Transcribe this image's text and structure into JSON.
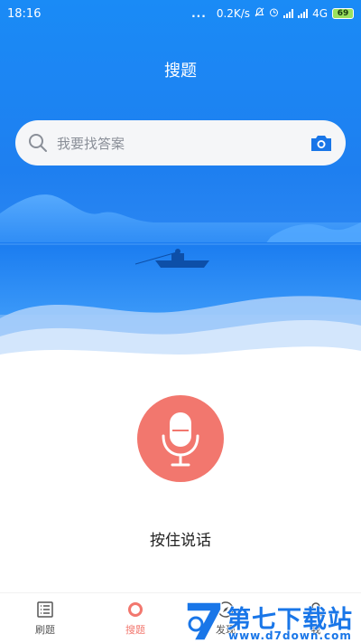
{
  "status_bar": {
    "time": "18:16",
    "dots": "...",
    "speed": "0.2K/s",
    "network": "4G",
    "battery": "69"
  },
  "header": {
    "title": "搜题"
  },
  "search": {
    "placeholder": "我要找答案",
    "left_icon": "search-icon",
    "right_icon": "camera-icon"
  },
  "voice": {
    "icon": "microphone-icon",
    "hint": "按住说话"
  },
  "nav": {
    "items": [
      {
        "label": "刷题",
        "icon": "list-icon",
        "active": false
      },
      {
        "label": "搜题",
        "icon": "search-circle-icon",
        "active": true
      },
      {
        "label": "发现",
        "icon": "discover-icon",
        "active": false
      },
      {
        "label": "我",
        "icon": "user-icon",
        "active": false
      }
    ]
  },
  "watermark": {
    "title": "第七下载站",
    "url": "www.d7down.com"
  },
  "colors": {
    "accent": "#f2776e",
    "primary": "#1e7ff0",
    "search_bg": "#f5f6f8"
  }
}
